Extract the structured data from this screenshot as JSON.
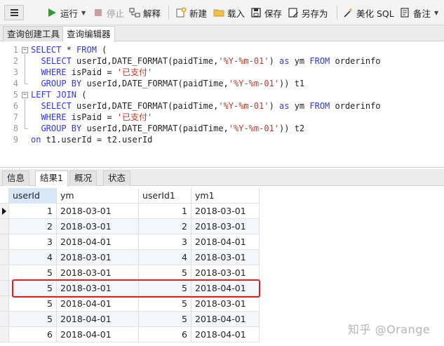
{
  "toolbar": {
    "run_label": "运行",
    "stop_label": "停止",
    "explain_label": "解释",
    "new_label": "新建",
    "load_label": "载入",
    "save_label": "保存",
    "save_as_label": "另存为",
    "beautify_label": "美化 SQL",
    "notes_label": "备注",
    "colors": {
      "run": "#2e9e2e",
      "stop": "#c9a1a1",
      "accent": "#2b3bd6"
    }
  },
  "top_tabs": [
    {
      "label": "查询创建工具",
      "active": false
    },
    {
      "label": "查询编辑器",
      "active": true
    }
  ],
  "editor": {
    "line_numbers": [
      "1",
      "2",
      "3",
      "4",
      "5",
      "6",
      "7",
      "8",
      "9"
    ],
    "lines": [
      [
        {
          "t": "SELECT",
          "k": "kw"
        },
        {
          "t": " * ",
          "k": ""
        },
        {
          "t": "FROM",
          "k": "kw"
        },
        {
          "t": " (",
          "k": ""
        }
      ],
      [
        {
          "t": "  SELECT",
          "k": "kw"
        },
        {
          "t": " userId,DATE_FORMAT(paidTime,",
          "k": ""
        },
        {
          "t": "'%Y-%m-01'",
          "k": "str"
        },
        {
          "t": ") ",
          "k": ""
        },
        {
          "t": "as",
          "k": "kw"
        },
        {
          "t": " ym ",
          "k": ""
        },
        {
          "t": "FROM",
          "k": "kw"
        },
        {
          "t": " orderinfo",
          "k": ""
        }
      ],
      [
        {
          "t": "  WHERE",
          "k": "kw"
        },
        {
          "t": " isPaid = ",
          "k": ""
        },
        {
          "t": "'已支付'",
          "k": "str"
        }
      ],
      [
        {
          "t": "  GROUP BY",
          "k": "kw"
        },
        {
          "t": " userId,DATE_FORMAT(paidTime,",
          "k": ""
        },
        {
          "t": "'%Y-%m-01'",
          "k": "str"
        },
        {
          "t": ")) t1",
          "k": ""
        }
      ],
      [
        {
          "t": "LEFT JOIN",
          "k": "kw"
        },
        {
          "t": " (",
          "k": ""
        }
      ],
      [
        {
          "t": "  SELECT",
          "k": "kw"
        },
        {
          "t": " userId,DATE_FORMAT(paidTime,",
          "k": ""
        },
        {
          "t": "'%Y-%m-01'",
          "k": "str"
        },
        {
          "t": ") ",
          "k": ""
        },
        {
          "t": "as",
          "k": "kw"
        },
        {
          "t": " ym ",
          "k": ""
        },
        {
          "t": "FROM",
          "k": "kw"
        },
        {
          "t": " orderinfo",
          "k": ""
        }
      ],
      [
        {
          "t": "  WHERE",
          "k": "kw"
        },
        {
          "t": " isPaid = ",
          "k": ""
        },
        {
          "t": "'已支付'",
          "k": "str"
        }
      ],
      [
        {
          "t": "  GROUP BY",
          "k": "kw"
        },
        {
          "t": " userId,DATE_FORMAT(paidTime,",
          "k": ""
        },
        {
          "t": "'%Y-%m-01'",
          "k": "str"
        },
        {
          "t": ")) t2",
          "k": ""
        }
      ],
      [
        {
          "t": "on",
          "k": "kw"
        },
        {
          "t": " t1.userId = t2.userId",
          "k": ""
        }
      ]
    ]
  },
  "result_tabs": [
    {
      "label": "信息",
      "active": false
    },
    {
      "label": "结果1",
      "active": true
    },
    {
      "label": "概况",
      "active": false
    },
    {
      "label": "状态",
      "active": false
    }
  ],
  "table": {
    "columns": [
      "userId",
      "ym",
      "userId1",
      "ym1"
    ],
    "rows": [
      [
        "1",
        "2018-03-01",
        "1",
        "2018-03-01"
      ],
      [
        "2",
        "2018-03-01",
        "2",
        "2018-03-01"
      ],
      [
        "3",
        "2018-04-01",
        "3",
        "2018-04-01"
      ],
      [
        "4",
        "2018-03-01",
        "4",
        "2018-03-01"
      ],
      [
        "5",
        "2018-03-01",
        "5",
        "2018-03-01"
      ],
      [
        "5",
        "2018-03-01",
        "5",
        "2018-04-01"
      ],
      [
        "5",
        "2018-04-01",
        "5",
        "2018-03-01"
      ],
      [
        "5",
        "2018-04-01",
        "5",
        "2018-04-01"
      ],
      [
        "6",
        "2018-04-01",
        "6",
        "2018-04-01"
      ]
    ],
    "current_row": 0,
    "highlighted_row": 5,
    "highlight_color": "#e02020"
  },
  "watermark": "知乎 @Orange"
}
